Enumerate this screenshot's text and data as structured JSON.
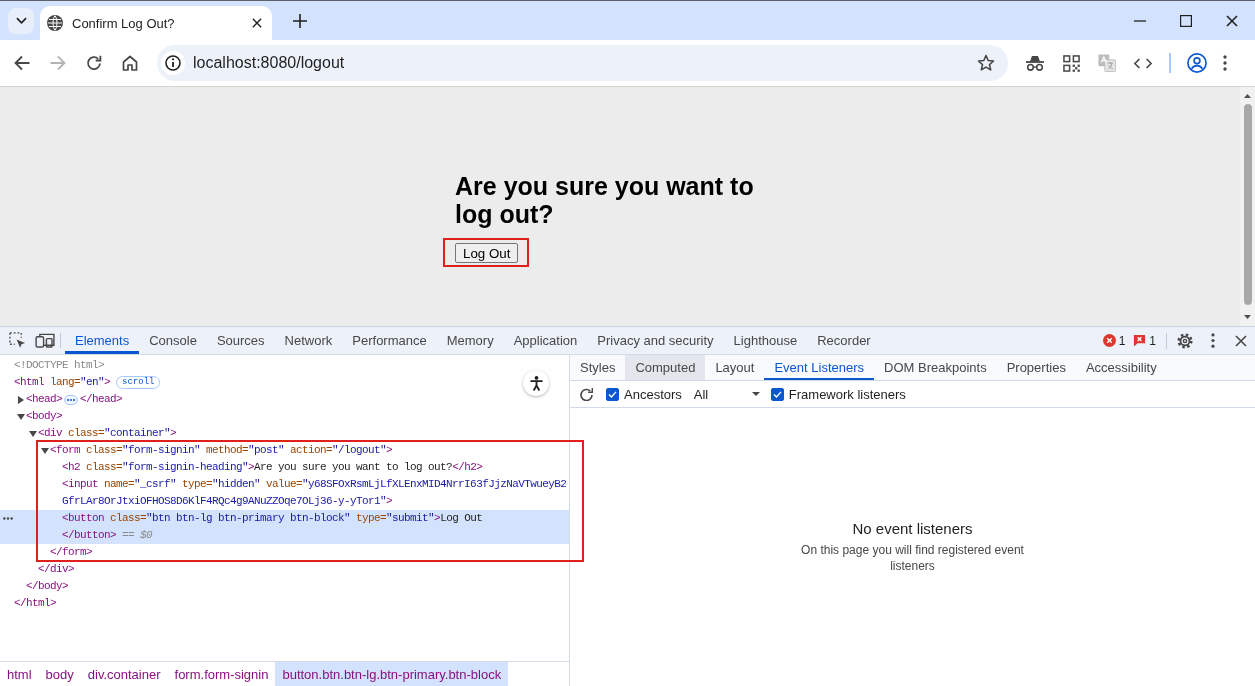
{
  "browser": {
    "tabs": [
      {
        "title": "Confirm Log Out?",
        "selected": true
      }
    ],
    "navigation": [
      {
        "kind": "back",
        "disabled": false
      },
      {
        "kind": "forward",
        "disabled": true
      },
      {
        "kind": "reload",
        "disabled": false
      },
      {
        "kind": "home",
        "disabled": false
      }
    ],
    "address": "localhost:8080/logout"
  },
  "page": {
    "heading": "Are you sure you want to log out?",
    "button": {
      "label": "Log Out",
      "annotated": true
    }
  },
  "devtools": {
    "tabs": [
      {
        "label": "Elements",
        "selected": true
      },
      {
        "label": "Console",
        "selected": false
      },
      {
        "label": "Sources",
        "selected": false
      },
      {
        "label": "Network",
        "selected": false
      },
      {
        "label": "Performance",
        "selected": false
      },
      {
        "label": "Memory",
        "selected": false
      },
      {
        "label": "Application",
        "selected": false
      },
      {
        "label": "Privacy and security",
        "selected": false
      },
      {
        "label": "Lighthouse",
        "selected": false
      },
      {
        "label": "Recorder",
        "selected": false
      }
    ],
    "errors": "1",
    "issues": "1",
    "dom_tree": [
      {
        "open": [
          {
            "kind": "doctype",
            "text": "<!DOCTYPE html>"
          }
        ],
        "selected": false
      },
      {
        "open": [
          {
            "kind": "tag",
            "text": "<html"
          },
          {
            "kind": "attr",
            "text": " lang="
          },
          {
            "kind": "value",
            "text": "\"en\""
          },
          {
            "kind": "tag",
            "text": ">"
          }
        ],
        "badge": "scroll",
        "selected": false,
        "children": [
          {
            "open": [
              {
                "kind": "tag",
                "text": "<head>"
              }
            ],
            "expanded": false,
            "selected": false,
            "close": [
              {
                "kind": "tag",
                "text": "</head>"
              }
            ]
          },
          {
            "open": [
              {
                "kind": "tag",
                "text": "<body>"
              }
            ],
            "expanded": true,
            "selected": false,
            "children": [
              {
                "open": [
                  {
                    "kind": "tag",
                    "text": "<div"
                  },
                  {
                    "kind": "attr",
                    "text": " class="
                  },
                  {
                    "kind": "value",
                    "text": "\"container\""
                  },
                  {
                    "kind": "tag",
                    "text": ">"
                  }
                ],
                "expanded": true,
                "selected": false,
                "children": [
                  {
                    "open": [
                      {
                        "kind": "tag",
                        "text": "<form"
                      },
                      {
                        "kind": "attr",
                        "text": " class="
                      },
                      {
                        "kind": "value",
                        "text": "\"form-signin\""
                      },
                      {
                        "kind": "attr",
                        "text": " method="
                      },
                      {
                        "kind": "value",
                        "text": "\"post\""
                      },
                      {
                        "kind": "attr",
                        "text": " action="
                      },
                      {
                        "kind": "value",
                        "text": "\"/logout\""
                      },
                      {
                        "kind": "tag",
                        "text": ">"
                      }
                    ],
                    "expanded": true,
                    "selected": false,
                    "annotated": true,
                    "children": [
                      {
                        "open": [
                          {
                            "kind": "tag",
                            "text": "<h2"
                          },
                          {
                            "kind": "attr",
                            "text": " class="
                          },
                          {
                            "kind": "value",
                            "text": "\"form-signin-heading\""
                          },
                          {
                            "kind": "tag",
                            "text": ">"
                          },
                          {
                            "kind": "text",
                            "text": "Are you sure you want to log out?"
                          },
                          {
                            "kind": "tag",
                            "text": "</h2>"
                          }
                        ],
                        "selected": false
                      },
                      {
                        "open": [
                          {
                            "kind": "tag",
                            "text": "<input"
                          },
                          {
                            "kind": "attr",
                            "text": " name="
                          },
                          {
                            "kind": "value",
                            "text": "\"_csrf\""
                          },
                          {
                            "kind": "attr",
                            "text": " type="
                          },
                          {
                            "kind": "value",
                            "text": "\"hidden\""
                          },
                          {
                            "kind": "attr",
                            "text": " value="
                          },
                          {
                            "kind": "value",
                            "text": "\"y68SFOxRsmLjLfXLEnxMID4NrrI63fJjzNaVTwueyB2GfrLAr8OrJtxiOFHOS8D6KlF4RQc4g9ANuZZOqe7OLj36-y-yTor1\""
                          },
                          {
                            "kind": "tag",
                            "text": ">"
                          }
                        ],
                        "selected": false
                      },
                      {
                        "open": [
                          {
                            "kind": "tag",
                            "text": "<button"
                          },
                          {
                            "kind": "attr",
                            "text": " class="
                          },
                          {
                            "kind": "value",
                            "text": "\"btn btn-lg btn-primary btn-block\""
                          },
                          {
                            "kind": "attr",
                            "text": " type="
                          },
                          {
                            "kind": "value",
                            "text": "\"submit\""
                          },
                          {
                            "kind": "tag",
                            "text": ">"
                          },
                          {
                            "kind": "text",
                            "text": "Log Out"
                          }
                        ],
                        "selected": true,
                        "close": [
                          {
                            "kind": "tag",
                            "text": "</button>"
                          },
                          {
                            "kind": "marker",
                            "text": " == $0"
                          }
                        ]
                      }
                    ],
                    "close": [
                      {
                        "kind": "tag",
                        "text": "</form>"
                      }
                    ]
                  }
                ],
                "close": [
                  {
                    "kind": "tag",
                    "text": "</div>"
                  }
                ]
              }
            ],
            "close": [
              {
                "kind": "tag",
                "text": "</body>"
              }
            ]
          }
        ],
        "close": [
          {
            "kind": "tag",
            "text": "</html>"
          }
        ]
      }
    ],
    "breadcrumbs": [
      {
        "label": "html",
        "selected": false
      },
      {
        "label": "body",
        "selected": false
      },
      {
        "label": "div.container",
        "selected": false
      },
      {
        "label": "form.form-signin",
        "selected": false
      },
      {
        "label": "button.btn.btn-lg.btn-primary.btn-block",
        "selected": true
      }
    ],
    "side_tabs": [
      {
        "label": "Styles",
        "selected": false,
        "hovered": false
      },
      {
        "label": "Computed",
        "selected": false,
        "hovered": true
      },
      {
        "label": "Layout",
        "selected": false,
        "hovered": false
      },
      {
        "label": "Event Listeners",
        "selected": true,
        "hovered": false
      },
      {
        "label": "DOM Breakpoints",
        "selected": false,
        "hovered": false
      },
      {
        "label": "Properties",
        "selected": false,
        "hovered": false
      },
      {
        "label": "Accessibility",
        "selected": false,
        "hovered": false
      }
    ],
    "listener_toolbar": {
      "ancestors": {
        "label": "Ancestors",
        "checked": true
      },
      "event_type": "All",
      "framework": {
        "label": "Framework listeners",
        "checked": true
      }
    },
    "empty_state": {
      "title": "No event listeners",
      "message": "On this page you will find registered event listeners"
    }
  }
}
